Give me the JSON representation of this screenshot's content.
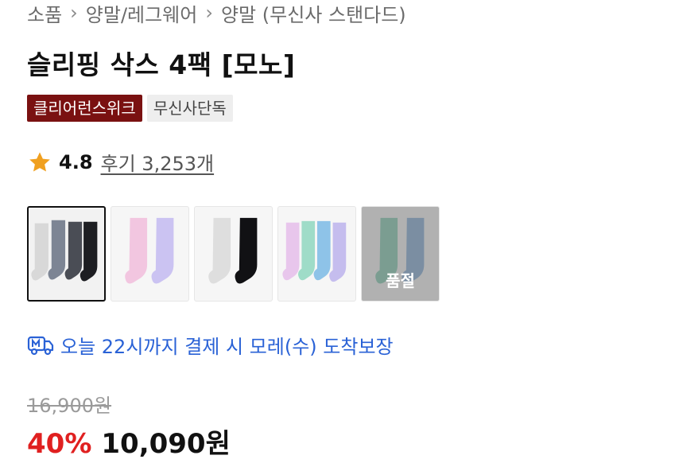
{
  "breadcrumb": {
    "items": [
      "소품",
      "양말/레그웨어",
      "양말 (무신사 스탠다드)"
    ],
    "separator": "›"
  },
  "product": {
    "title": "슬리핑 삭스 4팩 [모노]",
    "badges": [
      "클리어런스위크",
      "무신사단독"
    ]
  },
  "rating": {
    "value": "4.8",
    "reviews_label": "후기 3,253개",
    "icon": "star-icon",
    "star_color": "#f0a020"
  },
  "options": {
    "soldout_label": "품절"
  },
  "delivery": {
    "text": "오늘 22시까지 결제 시 모레(수) 도착보장",
    "icon": "delivery-truck-icon",
    "color": "#2a62d6"
  },
  "price": {
    "original": "16,900원",
    "discount": "40%",
    "sale": "10,090원",
    "discount_color": "#e02020"
  }
}
